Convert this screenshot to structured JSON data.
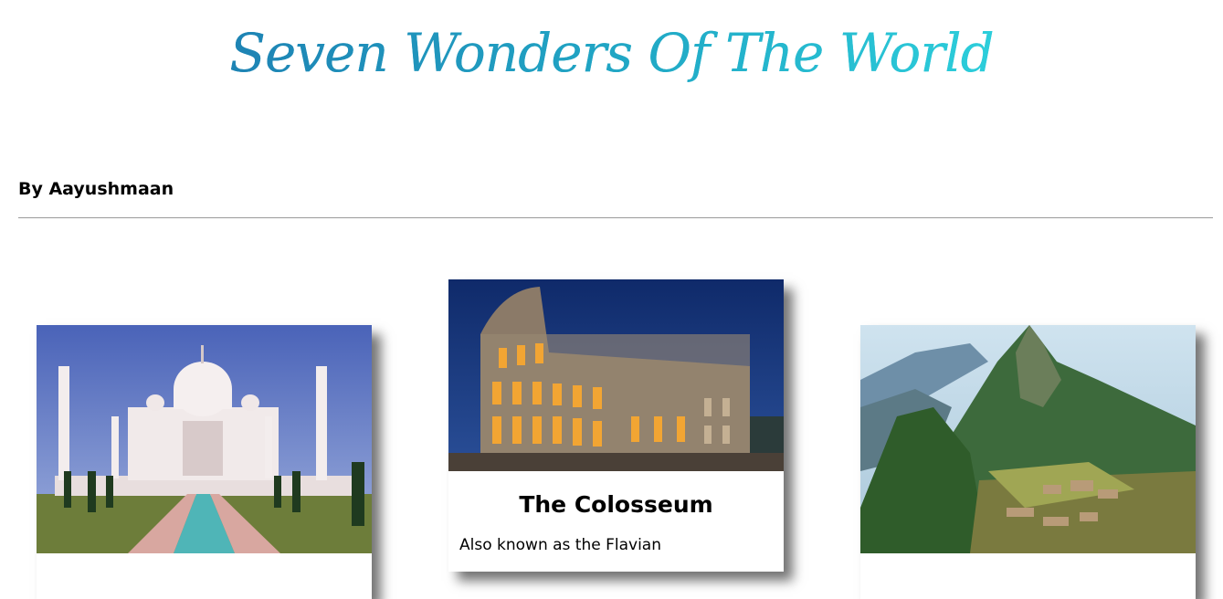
{
  "page": {
    "title": "Seven Wonders Of The World",
    "byline": "By Aayushmaan"
  },
  "cards": [
    {
      "image": "taj-mahal-photo",
      "title": "",
      "text": ""
    },
    {
      "image": "colosseum-photo",
      "title": "The Colosseum",
      "text": "Also known as the Flavian"
    },
    {
      "image": "machu-picchu-photo",
      "title": "",
      "text": ""
    }
  ],
  "colors": {
    "title_gradient_start": "#1e83b4",
    "title_gradient_end": "#2ccedb",
    "rule": "#9a9a9a"
  }
}
